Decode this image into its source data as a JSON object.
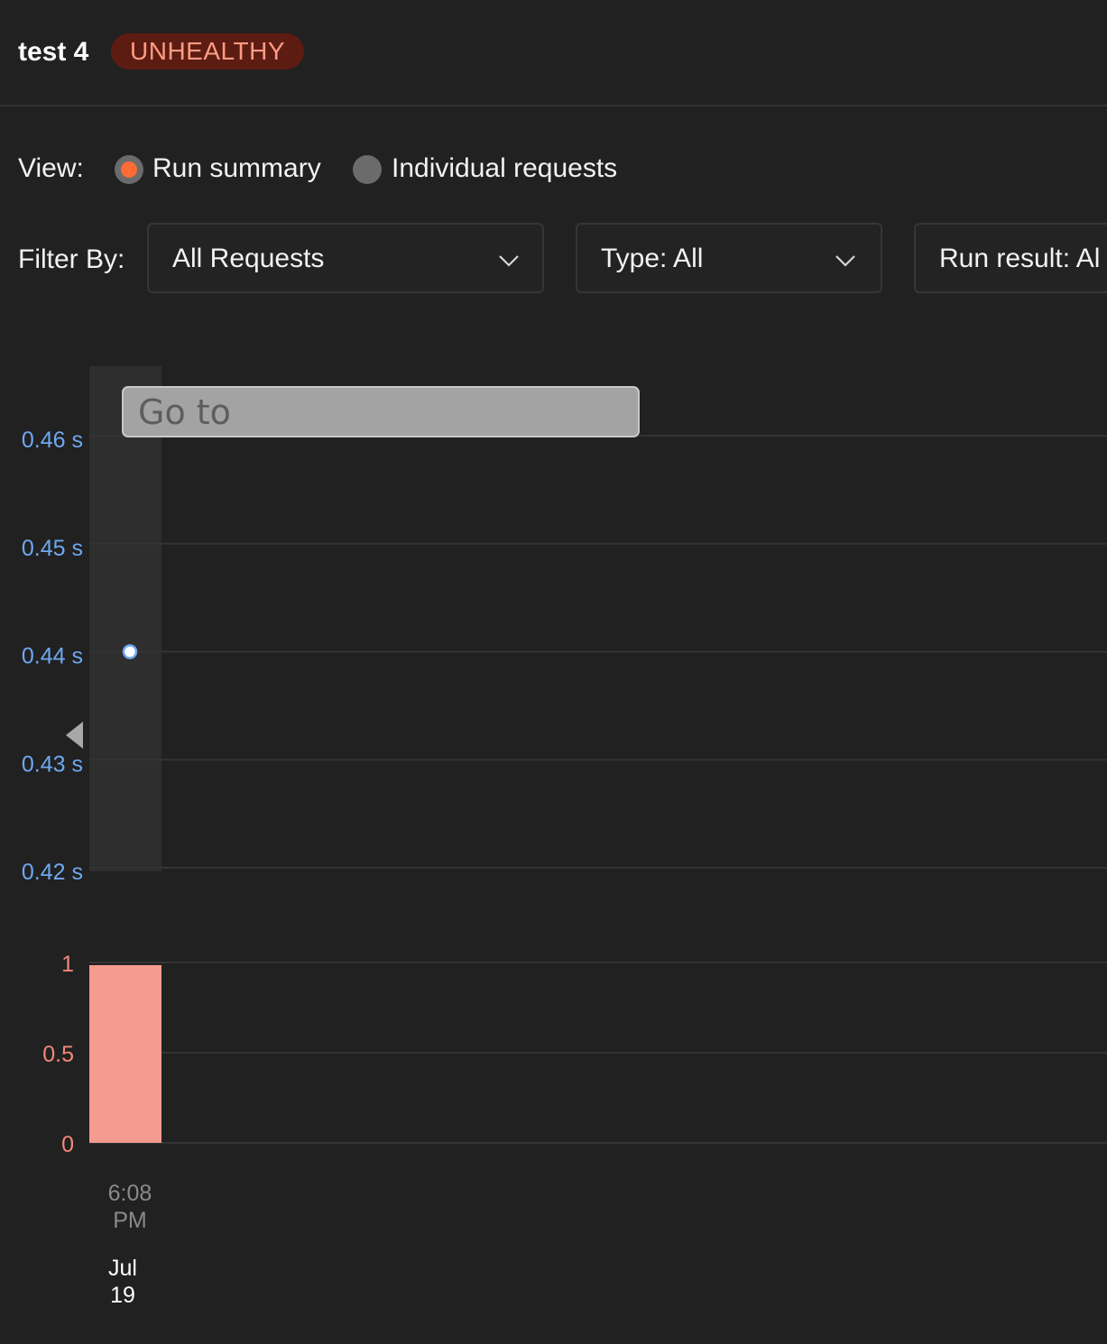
{
  "header": {
    "title": "test 4",
    "status": "UNHEALTHY"
  },
  "view": {
    "label": "View:",
    "options": [
      {
        "label": "Run summary",
        "selected": true
      },
      {
        "label": "Individual requests",
        "selected": false
      }
    ]
  },
  "filters": {
    "label": "Filter By:",
    "requests": "All Requests",
    "type": "Type: All",
    "run_result": "Run result: Al"
  },
  "goto": {
    "placeholder": "Go to"
  },
  "colors": {
    "accent": "#ff6c37",
    "time_axis": "#6fa8f0",
    "count_axis": "#f3877a",
    "bar": "#f59b8f",
    "badge_bg": "#5c1c12",
    "badge_text": "#ff9b83"
  },
  "chart_data": [
    {
      "type": "scatter",
      "y_tick_labels": [
        "0.46 s",
        "0.45 s",
        "0.44 s",
        "0.43 s",
        "0.42 s"
      ],
      "ylim": [
        0.42,
        0.46
      ],
      "points": [
        {
          "x": "6:08 PM",
          "y": 0.44
        }
      ]
    },
    {
      "type": "bar",
      "y_tick_labels": [
        "1",
        "0.5",
        "0"
      ],
      "ylim": [
        0,
        1
      ],
      "categories": [
        "6:08 PM"
      ],
      "values": [
        1
      ]
    }
  ],
  "x_axis": {
    "time_line1": "6:08",
    "time_line2": "PM",
    "date_line1": "Jul",
    "date_line2": "19"
  }
}
